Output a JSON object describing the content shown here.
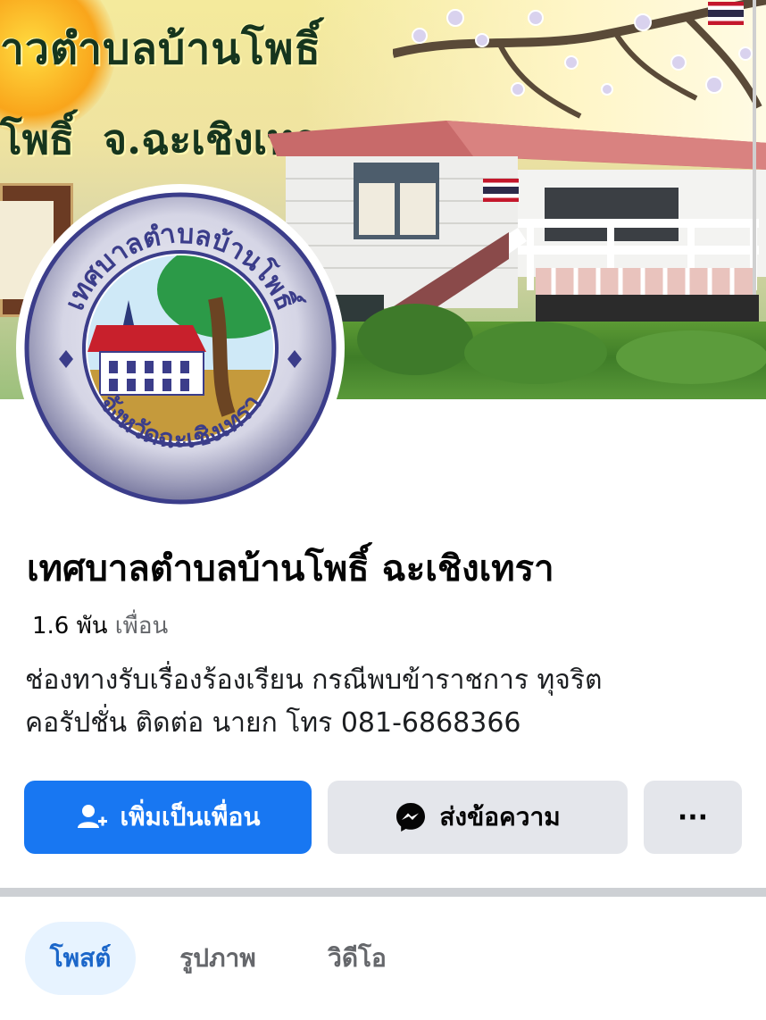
{
  "cover": {
    "banner_line1": "าวตำบลบ้านโพธิ์",
    "banner_line2": "โพธิ์  จ.ฉะเชิงเทรา"
  },
  "avatar": {
    "seal_top_text": "เทศบาลตำบลบ้านโพธิ์",
    "seal_bottom_text": "จังหวัดฉะเชิงเทรา"
  },
  "profile": {
    "name": "เทศบาลตำบลบ้านโพธิ์ ฉะเชิงเทรา",
    "friends_count": "1.6 พัน",
    "friends_label": "เพื่อน",
    "bio_line1": "ช่องทางรับเรื่องร้องเรียน กรณีพบข้าราชการ ทุจริต",
    "bio_line2": "คอรัปชั่น ติดต่อ นายก โทร 081-6868366"
  },
  "actions": {
    "add_friend_label": "เพิ่มเป็นเพื่อน",
    "add_friend_icon": "add-friend-icon",
    "message_label": "ส่งข้อความ",
    "message_icon": "messenger-icon",
    "more_label": "···"
  },
  "tabs": [
    {
      "label": "โพสต์",
      "active": true
    },
    {
      "label": "รูปภาพ",
      "active": false
    },
    {
      "label": "วิดีโอ",
      "active": false
    }
  ],
  "colors": {
    "primary": "#1877f2",
    "secondary_button": "#e4e6eb",
    "active_tab_bg": "#e7f3ff",
    "active_tab_text": "#1b66c9",
    "muted_text": "#65676b"
  }
}
